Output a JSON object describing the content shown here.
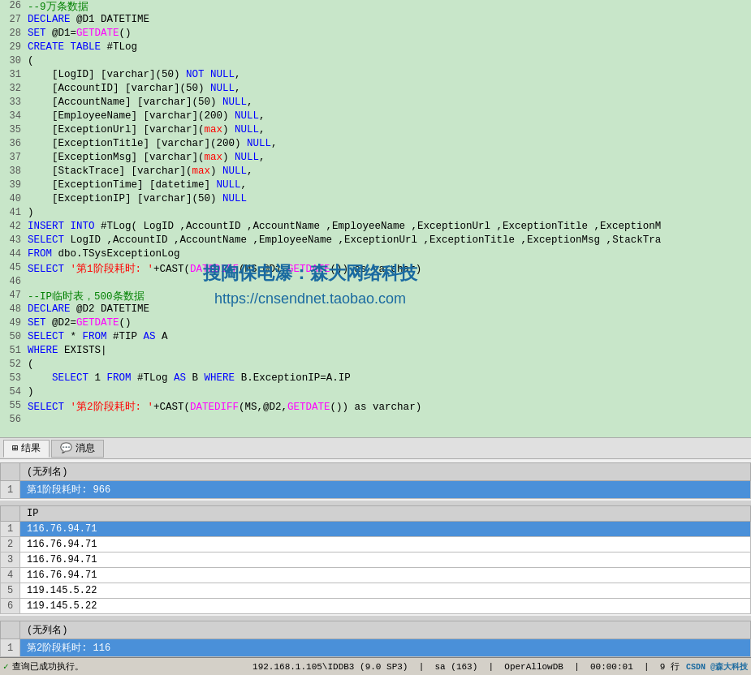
{
  "editor": {
    "lines": [
      {
        "num": 26,
        "content": "--9万条数据",
        "type": "comment"
      },
      {
        "num": 27,
        "content": "DECLARE @D1 DATETIME",
        "type": "code"
      },
      {
        "num": 28,
        "content": "SET @D1=GETDATE()",
        "type": "code"
      },
      {
        "num": 29,
        "content": "CREATE TABLE #TLog",
        "type": "code"
      },
      {
        "num": 30,
        "content": "(",
        "type": "code"
      },
      {
        "num": 31,
        "content": "    [LogID] [varchar](50) NOT NULL,",
        "type": "code"
      },
      {
        "num": 32,
        "content": "    [AccountID] [varchar](50) NULL,",
        "type": "code"
      },
      {
        "num": 33,
        "content": "    [AccountName] [varchar](50) NULL,",
        "type": "code"
      },
      {
        "num": 34,
        "content": "    [EmployeeName] [varchar](200) NULL,",
        "type": "code"
      },
      {
        "num": 35,
        "content": "    [ExceptionUrl] [varchar](max) NULL,",
        "type": "code"
      },
      {
        "num": 36,
        "content": "    [ExceptionTitle] [varchar](200) NULL,",
        "type": "code"
      },
      {
        "num": 37,
        "content": "    [ExceptionMsg] [varchar](max) NULL,",
        "type": "code"
      },
      {
        "num": 38,
        "content": "    [StackTrace] [varchar](max) NULL,",
        "type": "code"
      },
      {
        "num": 39,
        "content": "    [ExceptionTime] [datetime] NULL,",
        "type": "code"
      },
      {
        "num": 40,
        "content": "    [ExceptionIP] [varchar](50) NULL",
        "type": "code"
      },
      {
        "num": 41,
        "content": ")",
        "type": "code"
      },
      {
        "num": 42,
        "content": "INSERT INTO #TLog( LogID ,AccountID ,AccountName ,EmployeeName ,ExceptionUrl ,ExceptionTitle ,ExceptionM",
        "type": "code"
      },
      {
        "num": 43,
        "content": "SELECT LogID ,AccountID ,AccountName ,EmployeeName ,ExceptionUrl ,ExceptionTitle ,ExceptionMsg ,StackTra",
        "type": "code"
      },
      {
        "num": 44,
        "content": "FROM dbo.TSysExceptionLog",
        "type": "code"
      },
      {
        "num": 45,
        "content": "SELECT '第1阶段耗时: '+CAST(DATEDIFF(MS,@D1,GETDATE()) as varchar)",
        "type": "code_mixed"
      },
      {
        "num": 46,
        "content": "",
        "type": "empty"
      },
      {
        "num": 47,
        "content": "--IP临时表，500条数据",
        "type": "comment"
      },
      {
        "num": 48,
        "content": "DECLARE @D2 DATETIME",
        "type": "code"
      },
      {
        "num": 49,
        "content": "SET @D2=GETDATE()",
        "type": "code"
      },
      {
        "num": 50,
        "content": "SELECT * FROM #TIP AS A",
        "type": "code"
      },
      {
        "num": 51,
        "content": "WHERE EXISTS|",
        "type": "code"
      },
      {
        "num": 52,
        "content": "(",
        "type": "code"
      },
      {
        "num": 53,
        "content": "    SELECT 1 FROM #TLog AS B WHERE B.ExceptionIP=A.IP",
        "type": "code"
      },
      {
        "num": 54,
        "content": ")",
        "type": "code"
      },
      {
        "num": 55,
        "content": "SELECT '第2阶段耗时: '+CAST(DATEDIFF(MS,@D2,GETDATE()) as varchar)",
        "type": "code_mixed"
      },
      {
        "num": 56,
        "content": "",
        "type": "empty"
      }
    ]
  },
  "tabs": [
    {
      "id": "results",
      "label": "结果",
      "icon": "grid",
      "active": true
    },
    {
      "id": "messages",
      "label": "消息",
      "icon": "chat",
      "active": false
    }
  ],
  "result_block1": {
    "headers": [
      "(无列名)"
    ],
    "rows": [
      {
        "rownum": "1",
        "col1": "第1阶段耗时: 966",
        "highlighted": true
      }
    ]
  },
  "result_block2": {
    "headers": [
      "IP"
    ],
    "rows": [
      {
        "rownum": "1",
        "col1": "116.76.94.71",
        "highlighted": true
      },
      {
        "rownum": "2",
        "col1": "116.76.94.71",
        "highlighted": false
      },
      {
        "rownum": "3",
        "col1": "116.76.94.71",
        "highlighted": false
      },
      {
        "rownum": "4",
        "col1": "116.76.94.71",
        "highlighted": false
      },
      {
        "rownum": "5",
        "col1": "119.145.5.22",
        "highlighted": false
      },
      {
        "rownum": "6",
        "col1": "119.145.5.22",
        "highlighted": false
      }
    ]
  },
  "result_block3": {
    "headers": [
      "(无列名)"
    ],
    "rows": [
      {
        "rownum": "1",
        "col1": "第2阶段耗时: 116",
        "highlighted": true
      }
    ]
  },
  "status": {
    "check_symbol": "✓",
    "message": "查询已成功执行。",
    "server": "192.168.1.105\\IDDB3 (9.0 SP3)",
    "user": "sa (163)",
    "db": "OperAllowDB",
    "time": "00:00:01",
    "rows": "9 行",
    "brand": "CSDN @森大科技"
  },
  "watermark": {
    "line1": "搜陶保电瀑：森大网络科技",
    "line2": "https://cnsendnet.taobao.com"
  }
}
